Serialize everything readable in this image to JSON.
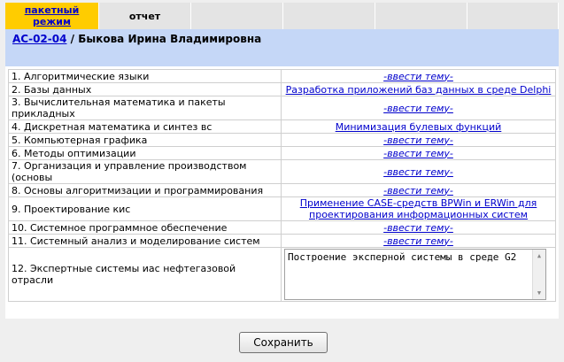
{
  "tabs": [
    {
      "label": "пакетный режим",
      "active": true
    },
    {
      "label": "отчет",
      "active": false
    },
    {
      "label": "",
      "active": false
    },
    {
      "label": "",
      "active": false
    },
    {
      "label": "",
      "active": false
    },
    {
      "label": "",
      "active": false
    }
  ],
  "header": {
    "group_code": "АС-02-04",
    "separator": " / ",
    "student_name": "Быкова Ирина Владимировна"
  },
  "subjects": [
    {
      "name": "1. Алгоритмические языки",
      "topic": "-ввести тему-"
    },
    {
      "name": "2. Базы данных",
      "topic": "Разработка приложений баз данных в среде Delphi"
    },
    {
      "name": "3. Вычислительная математика и пакеты прикладных",
      "topic": "-ввести тему-"
    },
    {
      "name": "4. Дискретная математика и синтез вс",
      "topic": "Минимизация булевых функций"
    },
    {
      "name": "5. Компьютерная графика",
      "topic": "-ввести тему-"
    },
    {
      "name": "6. Методы оптимизации",
      "topic": "-ввести тему-"
    },
    {
      "name": "7. Организация и управление производством (основы",
      "topic": "-ввести тему-"
    },
    {
      "name": "8. Основы алгоритмизации и программирования",
      "topic": "-ввести тему-"
    },
    {
      "name": "9. Проектирование кис",
      "topic": "Применение CASE-средств BPWin и ERWin для проектирования информационных систем"
    },
    {
      "name": "10. Системное программное обеспечение",
      "topic": "-ввести тему-"
    },
    {
      "name": "11. Системный анализ и моделирование систем",
      "topic": "-ввести тему-"
    },
    {
      "name": "12. Экспертные системы иас нефтегазовой отрасли",
      "topic_value": "Построение эксперной системы в среде G2"
    }
  ],
  "buttons": {
    "save": "Сохранить"
  },
  "colors": {
    "active_tab": "#ffcc00",
    "header_bg": "#c5d7f7",
    "link": "#0000cc"
  }
}
